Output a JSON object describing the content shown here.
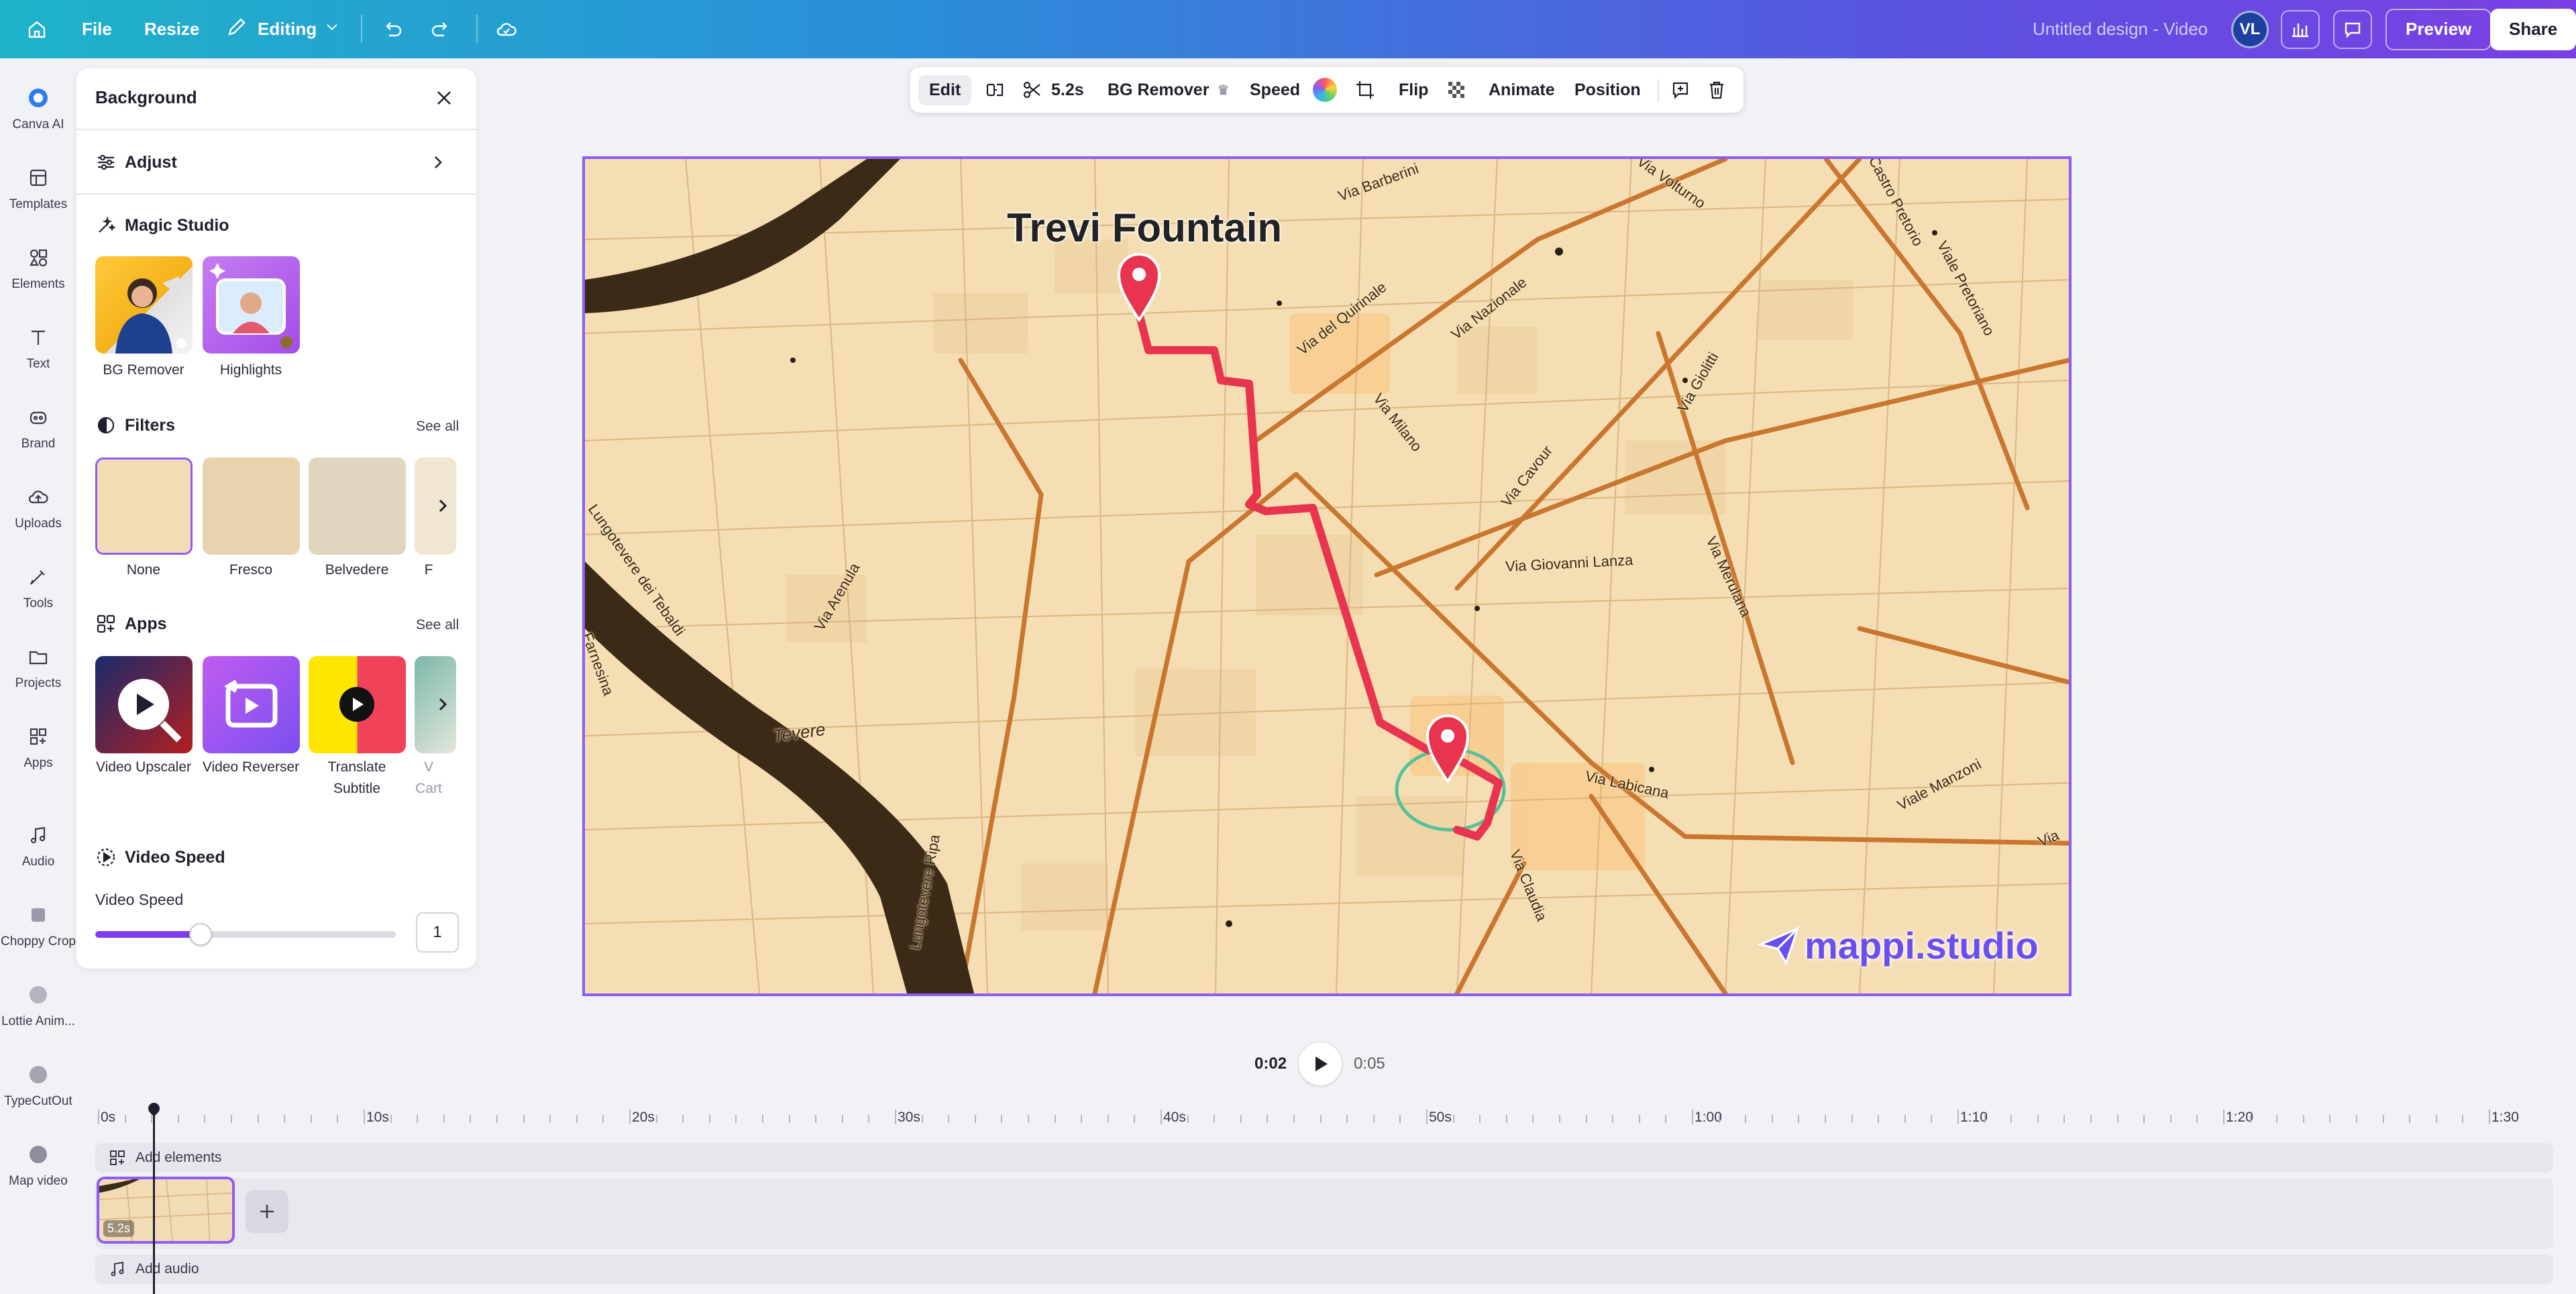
{
  "topbar": {
    "home_icon": "home-icon",
    "file_label": "File",
    "resize_label": "Resize",
    "mode_label": "Editing",
    "doc_title": "Untitled design - Video",
    "avatar_initials": "VL",
    "preview_label": "Preview",
    "share_label": "Share"
  },
  "rail": [
    {
      "label": "Canva AI",
      "icon": "canva-ai-icon"
    },
    {
      "label": "Templates",
      "icon": "templates-icon"
    },
    {
      "label": "Elements",
      "icon": "elements-icon"
    },
    {
      "label": "Text",
      "icon": "text-icon"
    },
    {
      "label": "Brand",
      "icon": "brand-icon"
    },
    {
      "label": "Uploads",
      "icon": "uploads-icon"
    },
    {
      "label": "Tools",
      "icon": "tools-icon"
    },
    {
      "label": "Projects",
      "icon": "projects-icon"
    },
    {
      "label": "Apps",
      "icon": "apps-icon"
    },
    {
      "label": "Audio",
      "icon": "audio-icon"
    },
    {
      "label": "Choppy Crop",
      "icon": "choppy-crop-icon"
    },
    {
      "label": "Lottie Anim...",
      "icon": "lottie-icon"
    },
    {
      "label": "TypeCutOut",
      "icon": "typecutout-icon"
    },
    {
      "label": "Map video",
      "icon": "map-video-icon"
    }
  ],
  "panel": {
    "title": "Background",
    "adjust_label": "Adjust",
    "magic_studio_label": "Magic Studio",
    "magic_items": [
      {
        "label": "BG Remover"
      },
      {
        "label": "Highlights"
      }
    ],
    "filters_label": "Filters",
    "filters_see_all": "See all",
    "filters": [
      {
        "label": "None"
      },
      {
        "label": "Fresco"
      },
      {
        "label": "Belvedere"
      },
      {
        "label": "F"
      }
    ],
    "apps_label": "Apps",
    "apps_see_all": "See all",
    "apps": [
      {
        "label_line1": "Video Upscaler",
        "label_line2": ""
      },
      {
        "label_line1": "Video Reverser",
        "label_line2": ""
      },
      {
        "label_line1": "Translate",
        "label_line2": "Subtitle"
      },
      {
        "label_line1": "V",
        "label_line2": "Cart"
      }
    ],
    "video_speed_section": "Video Speed",
    "video_speed_label": "Video Speed",
    "video_speed_value": "1",
    "video_speed_fraction": 0.35
  },
  "context_toolbar": {
    "edit_label": "Edit",
    "duration_label": "5.2s",
    "bg_remover_label": "BG Remover",
    "speed_label": "Speed",
    "flip_label": "Flip",
    "animate_label": "Animate",
    "position_label": "Position"
  },
  "canvas": {
    "map_title": "Trevi Fountain",
    "watermark": "mappi.studio",
    "streets": [
      "Via Barberini",
      "Via Volturno",
      "Castro Pretorio",
      "Viale Pretoriano",
      "Via del Quirinale",
      "Via Nazionale",
      "Via Milano",
      "Via Cavour",
      "Via Giolitti",
      "Via Giovanni Lanza",
      "Via Merulana",
      "Via Labicana",
      "Viale Manzoni",
      "Via Claudia",
      "Via Arenula",
      "Tevere",
      "Lungotevere Ripa",
      "Farnesina",
      "Lungotevere dei Tebaldi",
      "Via"
    ],
    "route_color": "#e8344e",
    "pin_color": "#e8344e"
  },
  "playback": {
    "current_time": "0:02",
    "total_time": "0:05"
  },
  "timeline": {
    "ticks": [
      "0s",
      "10s",
      "20s",
      "30s",
      "40s",
      "50s",
      "1:00",
      "1:10",
      "1:20",
      "1:30"
    ],
    "add_elements_label": "Add elements",
    "add_audio_label": "Add audio",
    "clip_duration": "5.2s"
  }
}
